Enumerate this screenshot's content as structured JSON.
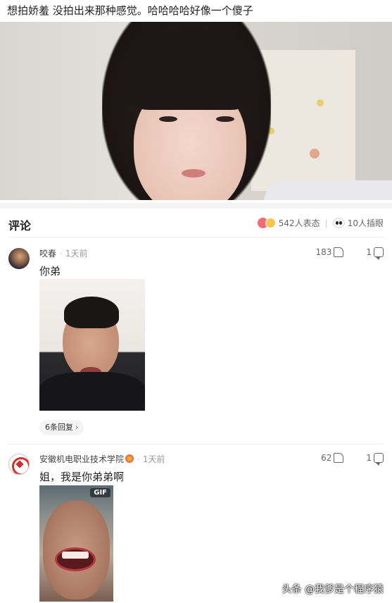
{
  "post": {
    "caption": "想拍娇羞 没拍出来那种感觉。哈哈哈哈好像一个傻子"
  },
  "comments_section": {
    "title": "评论",
    "reactions_label": "542人表态",
    "eyes_label": "10人插眼"
  },
  "comments": [
    {
      "username": "咬春",
      "time": "1天前",
      "likes": "183",
      "replies_count": "1",
      "text": "你弟",
      "replies_link": "6条回复"
    },
    {
      "username": "安徽机电职业技术学院",
      "time": "1天前",
      "likes": "62",
      "replies_count": "1",
      "text": "姐，我是你弟弟啊",
      "gif_tag": "GIF"
    }
  ],
  "watermark": "头条 @我爹是个程序猿",
  "colors": {
    "reaction_heart": "#f06b75",
    "reaction_face": "#f6c54d",
    "school_logo": "#c9322e"
  },
  "icons": [
    "heart-reaction-icon",
    "emoji-reaction-icon",
    "eyes-icon",
    "like-icon",
    "reply-icon",
    "chevron-right-icon",
    "badge-icon"
  ]
}
